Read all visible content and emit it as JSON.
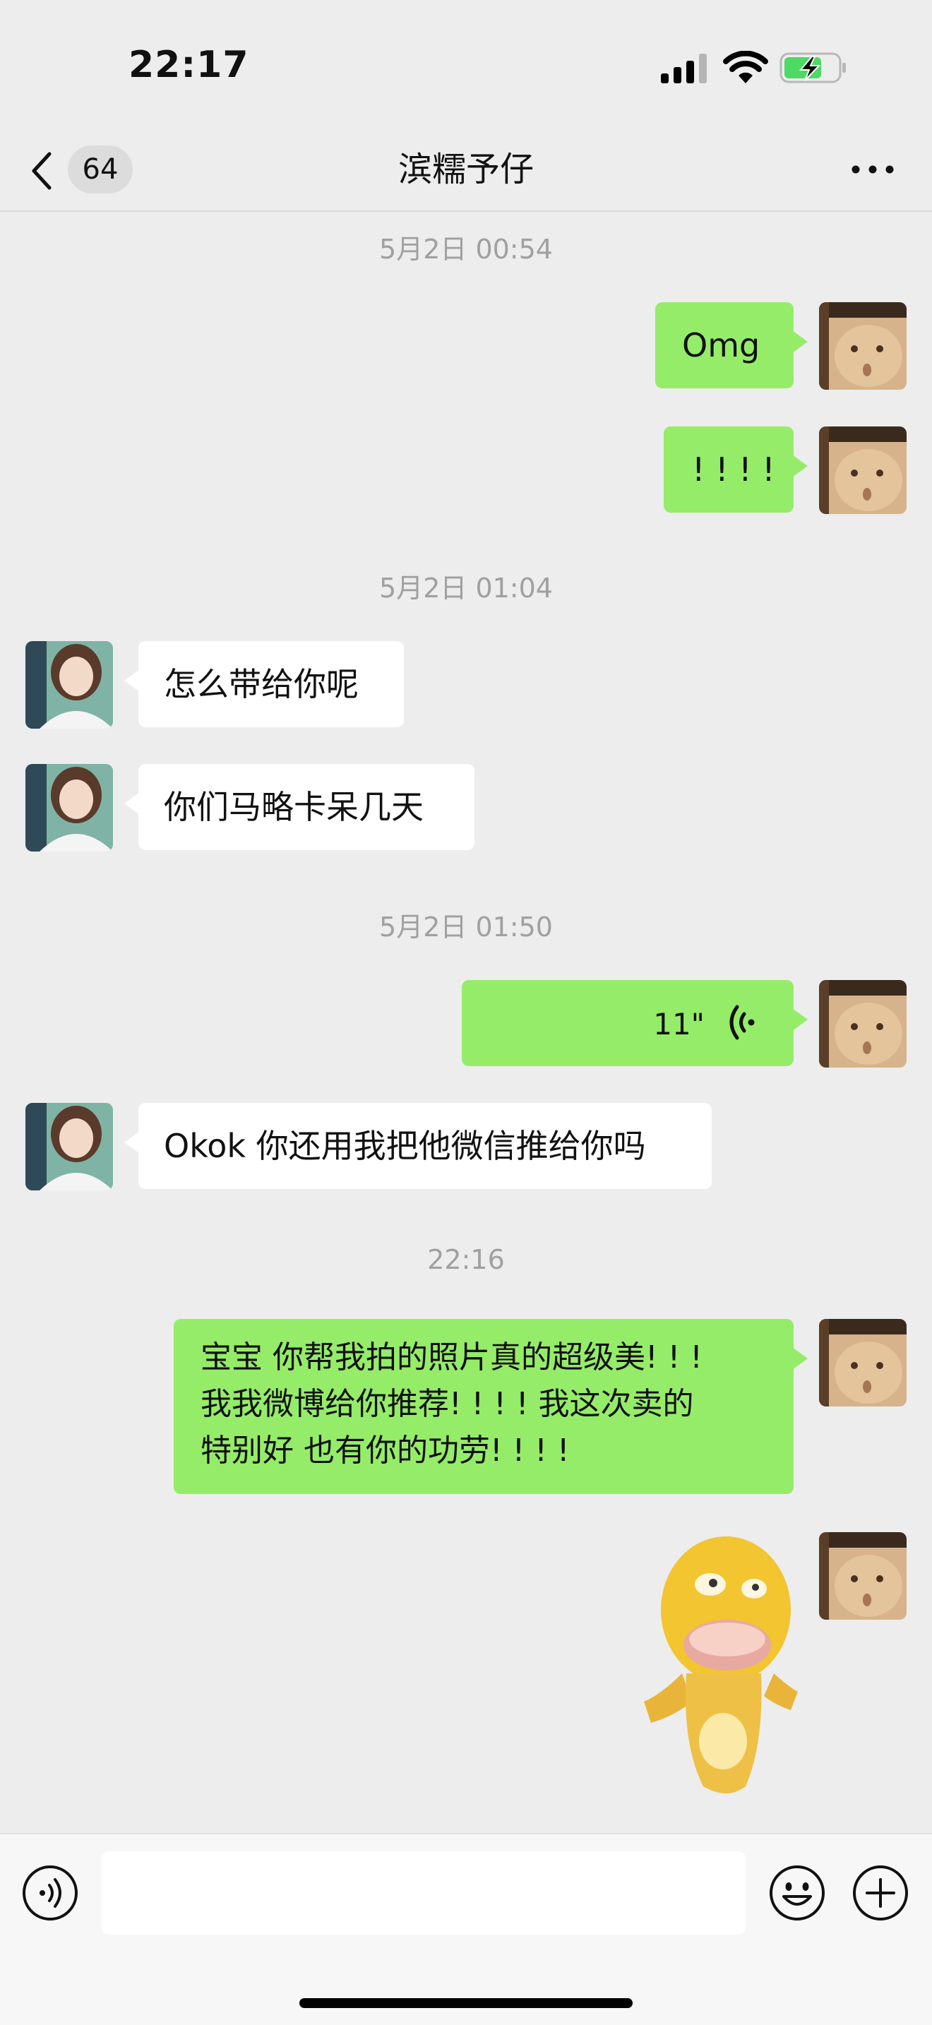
{
  "status_bar": {
    "time": "22:17"
  },
  "nav": {
    "unread_count": "64",
    "title": "滨糯予仔"
  },
  "messages": [
    {
      "type": "timestamp",
      "text": "5月2日 00:54"
    },
    {
      "type": "text",
      "from": "me",
      "text": "Omg"
    },
    {
      "type": "text",
      "from": "me",
      "text": "! ! ! !"
    },
    {
      "type": "timestamp",
      "text": "5月2日 01:04"
    },
    {
      "type": "text",
      "from": "them",
      "text": "怎么带给你呢"
    },
    {
      "type": "text",
      "from": "them",
      "text": "你们马略卡呆几天"
    },
    {
      "type": "timestamp",
      "text": "5月2日 01:50"
    },
    {
      "type": "voice",
      "from": "me",
      "duration": "11\""
    },
    {
      "type": "text",
      "from": "them",
      "text": "Okok 你还用我把他微信推给你吗"
    },
    {
      "type": "timestamp",
      "text": "22:16"
    },
    {
      "type": "text",
      "from": "me",
      "lines": [
        "宝宝 你帮我拍的照片真的超级美! ! !",
        "我我微博给你推荐! ! ! !  我这次卖的",
        "特别好 也有你的功劳! ! ! !"
      ]
    },
    {
      "type": "sticker",
      "from": "me"
    }
  ],
  "input_bar": {
    "value": "",
    "placeholder": ""
  },
  "colors": {
    "my_bubble": "#95ec69",
    "their_bubble": "#ffffff",
    "background": "#ededed",
    "timestamp": "#a0a0a0"
  },
  "icons": [
    "back-chevron-icon",
    "more-icon",
    "voice-mode-icon",
    "emoji-icon",
    "plus-icon",
    "voice-wave-icon"
  ]
}
